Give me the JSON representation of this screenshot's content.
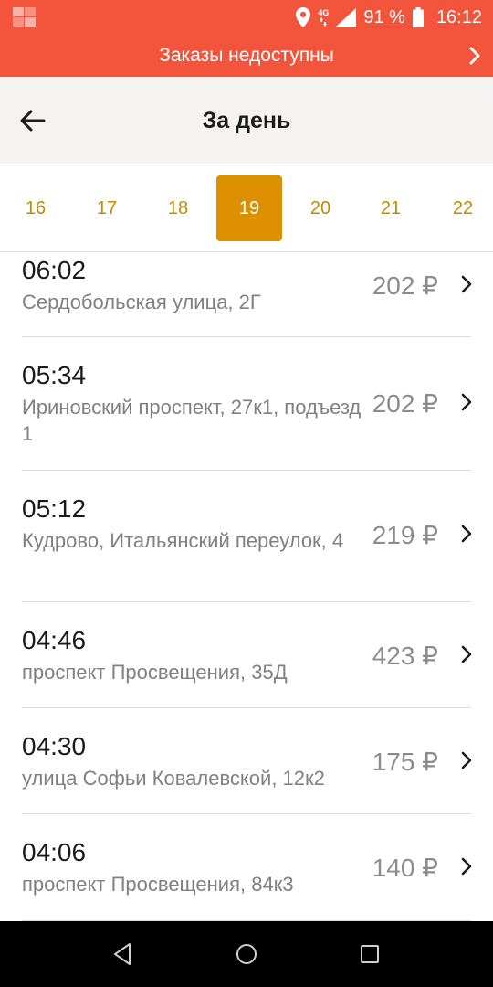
{
  "status_bar": {
    "network": "4G",
    "battery": "91 %",
    "time": "16:12",
    "icons": [
      "location-icon",
      "signal-icon",
      "battery-icon"
    ]
  },
  "banner": {
    "text": "Заказы недоступны"
  },
  "header": {
    "title": "За день"
  },
  "dates": {
    "items": [
      "16",
      "17",
      "18",
      "19",
      "20",
      "21",
      "22"
    ],
    "selected": "19"
  },
  "orders": [
    {
      "time": "06:02",
      "address": "Сердобольская улица, 2Г",
      "price": "202 ₽"
    },
    {
      "time": "05:34",
      "address": "Ириновский проспект, 27к1, подъезд 1",
      "price": "202 ₽"
    },
    {
      "time": "05:12",
      "address": "Кудрово, Итальянский переулок, 4",
      "price": "219 ₽"
    },
    {
      "time": "04:46",
      "address": "проспект Просвещения, 35Д",
      "price": "423 ₽"
    },
    {
      "time": "04:30",
      "address": "улица Софьи Ковалевской, 12к2",
      "price": "175 ₽"
    },
    {
      "time": "04:06",
      "address": "проспект Просвещения, 84к3",
      "price": "140 ₽"
    }
  ],
  "colors": {
    "accent": "#f2553c",
    "date_selected": "#dc9000",
    "date_text": "#c38c00"
  }
}
